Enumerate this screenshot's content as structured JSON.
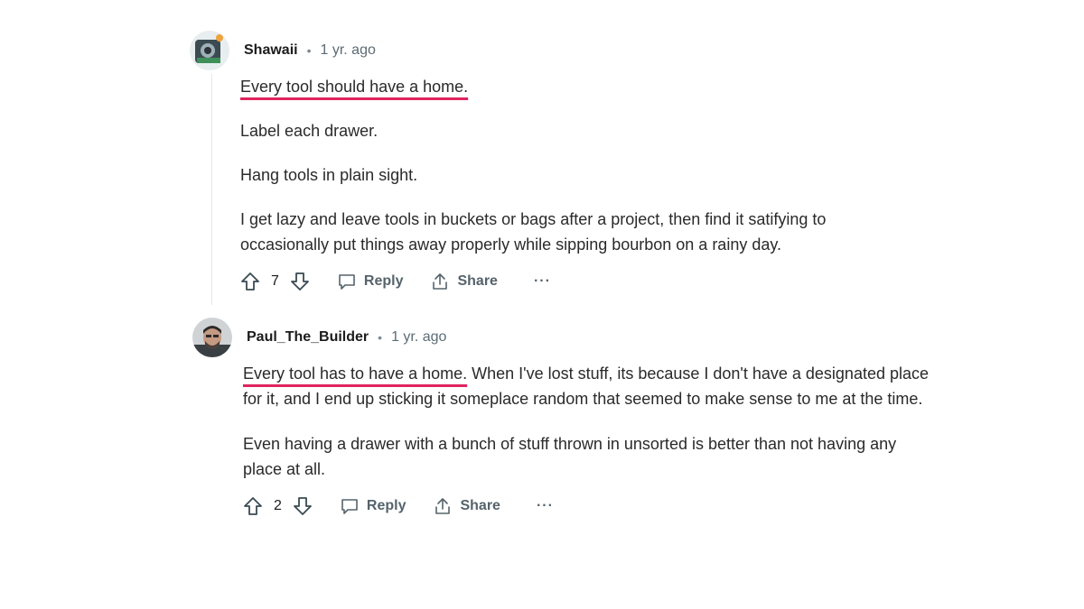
{
  "comments": [
    {
      "author": "Shawaii",
      "separator": "•",
      "time": "1 yr. ago",
      "highlight": "Every tool should have a home.",
      "paragraphs": [
        "Label each drawer.",
        "Hang tools in plain sight.",
        "I get lazy and leave tools in buckets or bags after a project, then find it satifying to occasionally put things away properly while sipping bourbon on a rainy day."
      ],
      "votes": "7",
      "reply_label": "Reply",
      "share_label": "Share",
      "more_label": "···"
    },
    {
      "author": "Paul_The_Builder",
      "separator": "•",
      "time": "1 yr. ago",
      "highlight": "Every tool has to have a home.",
      "first_rest": " When I've lost stuff, its because I don't have a designated place for it, and I end up sticking it someplace random that seemed to make sense to me at the time.",
      "paragraphs": [
        "Even having a drawer with a bunch of stuff thrown in unsorted is better than not having any place at all."
      ],
      "votes": "2",
      "reply_label": "Reply",
      "share_label": "Share",
      "more_label": "···"
    }
  ],
  "colors": {
    "highlight_underline": "#e0245e",
    "meta": "#5c6c74",
    "action": "#56636b"
  },
  "icons": [
    "upvote-icon",
    "downvote-icon",
    "reply-bubble-icon",
    "share-icon",
    "more-icon"
  ]
}
